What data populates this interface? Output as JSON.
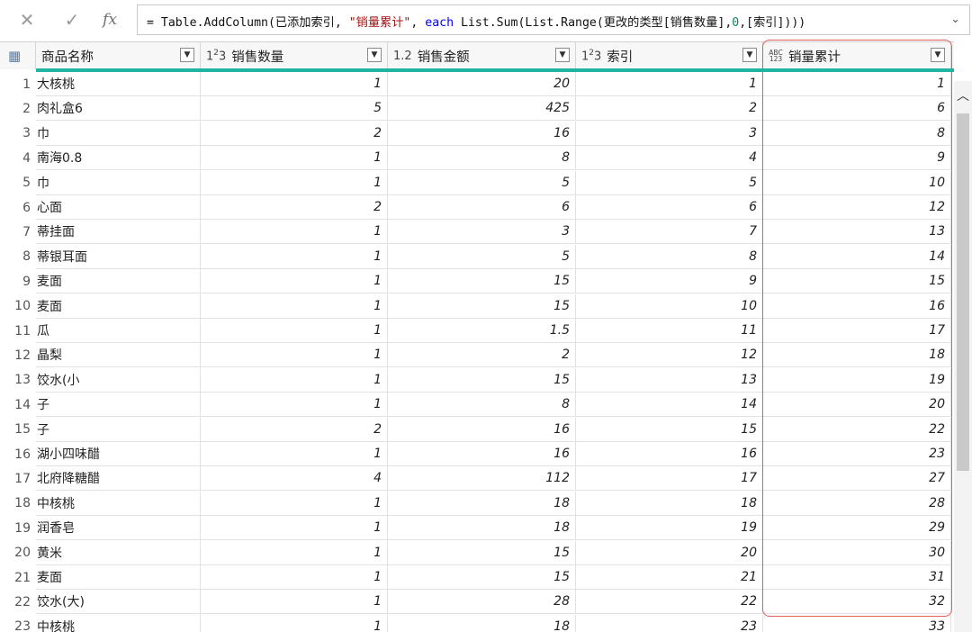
{
  "formula": {
    "cancel_glyph": "✕",
    "commit_glyph": "✓",
    "fx_label": "fx",
    "parts": {
      "p1": "= Table.AddColumn(已添加索引, ",
      "p2": "\"销量累计\"",
      "p3": ", ",
      "p4": "each",
      "p5": " List.Sum(List.Range(更改的类型[销售数量],",
      "p6": "0",
      "p7": ",[索引])))"
    },
    "expand_glyph": "⌄"
  },
  "columns": [
    {
      "type_icon": "",
      "label": "商品名称"
    },
    {
      "type_icon": "1²3",
      "label": "销售数量"
    },
    {
      "type_icon": "1.2",
      "label": "销售金额"
    },
    {
      "type_icon": "1²3",
      "label": "索引"
    },
    {
      "type_icon": "ABC 123",
      "label": "销量累计"
    }
  ],
  "rows": [
    {
      "n": "1",
      "name": "大核桃",
      "qty": "1",
      "amt": "20",
      "idx": "1",
      "cum": "1"
    },
    {
      "n": "2",
      "name": "肉礼盒6",
      "qty": "5",
      "amt": "425",
      "idx": "2",
      "cum": "6"
    },
    {
      "n": "3",
      "name": "巾",
      "qty": "2",
      "amt": "16",
      "idx": "3",
      "cum": "8"
    },
    {
      "n": "4",
      "name": "南海0.8",
      "qty": "1",
      "amt": "8",
      "idx": "4",
      "cum": "9"
    },
    {
      "n": "5",
      "name": "巾",
      "qty": "1",
      "amt": "5",
      "idx": "5",
      "cum": "10"
    },
    {
      "n": "6",
      "name": "心面",
      "qty": "2",
      "amt": "6",
      "idx": "6",
      "cum": "12"
    },
    {
      "n": "7",
      "name": "蒂挂面",
      "qty": "1",
      "amt": "3",
      "idx": "7",
      "cum": "13"
    },
    {
      "n": "8",
      "name": "蒂银耳面",
      "qty": "1",
      "amt": "5",
      "idx": "8",
      "cum": "14"
    },
    {
      "n": "9",
      "name": "麦面",
      "qty": "1",
      "amt": "15",
      "idx": "9",
      "cum": "15"
    },
    {
      "n": "10",
      "name": "麦面",
      "qty": "1",
      "amt": "15",
      "idx": "10",
      "cum": "16"
    },
    {
      "n": "11",
      "name": "瓜",
      "qty": "1",
      "amt": "1.5",
      "idx": "11",
      "cum": "17"
    },
    {
      "n": "12",
      "name": "晶梨",
      "qty": "1",
      "amt": "2",
      "idx": "12",
      "cum": "18"
    },
    {
      "n": "13",
      "name": "饺水(小",
      "qty": "1",
      "amt": "15",
      "idx": "13",
      "cum": "19"
    },
    {
      "n": "14",
      "name": "子",
      "qty": "1",
      "amt": "8",
      "idx": "14",
      "cum": "20"
    },
    {
      "n": "15",
      "name": "子",
      "qty": "2",
      "amt": "16",
      "idx": "15",
      "cum": "22"
    },
    {
      "n": "16",
      "name": "湖小四味醋",
      "qty": "1",
      "amt": "16",
      "idx": "16",
      "cum": "23"
    },
    {
      "n": "17",
      "name": "北府降糖醋",
      "qty": "4",
      "amt": "112",
      "idx": "17",
      "cum": "27"
    },
    {
      "n": "18",
      "name": "中核桃",
      "qty": "1",
      "amt": "18",
      "idx": "18",
      "cum": "28"
    },
    {
      "n": "19",
      "name": "润香皂",
      "qty": "1",
      "amt": "18",
      "idx": "19",
      "cum": "29"
    },
    {
      "n": "20",
      "name": "黄米",
      "qty": "1",
      "amt": "15",
      "idx": "20",
      "cum": "30"
    },
    {
      "n": "21",
      "name": "麦面",
      "qty": "1",
      "amt": "15",
      "idx": "21",
      "cum": "31"
    },
    {
      "n": "22",
      "name": "饺水(大)",
      "qty": "1",
      "amt": "28",
      "idx": "22",
      "cum": "32"
    },
    {
      "n": "23",
      "name": "中核桃",
      "qty": "1",
      "amt": "18",
      "idx": "23",
      "cum": "33"
    }
  ],
  "colors": {
    "accent_bar": "#22b3a3",
    "highlight": "#e25d57"
  }
}
